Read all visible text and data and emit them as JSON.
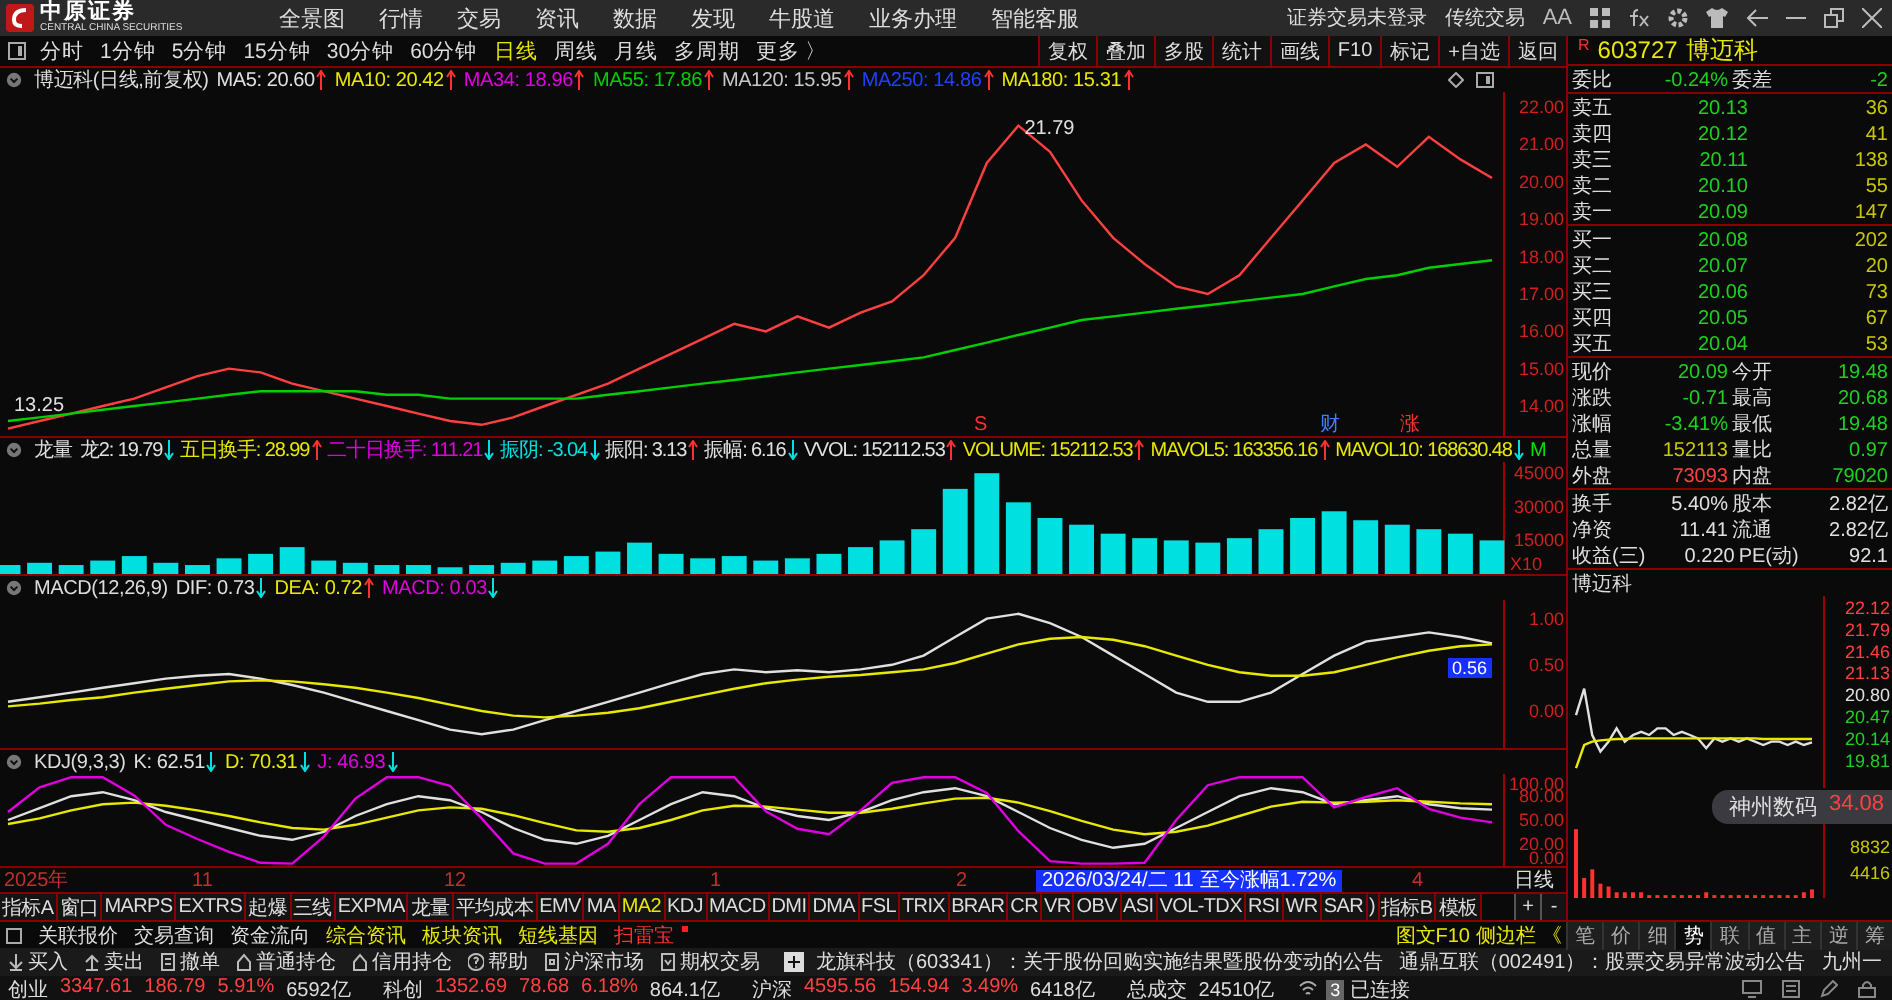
{
  "app_header": {
    "logo_text": "中原证券",
    "logo_subtitle": "CENTRAL CHINA SECURITIES",
    "nav": [
      "全景图",
      "行情",
      "交易",
      "资讯",
      "数据",
      "发现",
      "牛股道",
      "业务办理",
      "智能客服"
    ],
    "status": [
      "证券交易未登录",
      "传统交易"
    ],
    "font_icon": "AA"
  },
  "periods": [
    {
      "label": "分时",
      "selected": false
    },
    {
      "label": "1分钟",
      "selected": false
    },
    {
      "label": "5分钟",
      "selected": false
    },
    {
      "label": "15分钟",
      "selected": false
    },
    {
      "label": "30分钟",
      "selected": false
    },
    {
      "label": "60分钟",
      "selected": false
    },
    {
      "label": "日线",
      "selected": true
    },
    {
      "label": "周线",
      "selected": false
    },
    {
      "label": "月线",
      "selected": false
    },
    {
      "label": "多周期",
      "selected": false
    },
    {
      "label": "更多 〉",
      "selected": false
    }
  ],
  "chart_tools": [
    "复权",
    "叠加",
    "多股",
    "统计",
    "画线",
    "F10",
    "标记",
    "+自选",
    "返回"
  ],
  "main_panel": {
    "title": "博迈科(日线,前复权)",
    "indicators": [
      {
        "text": "MA5: 20.60",
        "rising": true,
        "color": "#e0e0e0"
      },
      {
        "text": "MA10: 20.42",
        "rising": true,
        "color": "#e8e800"
      },
      {
        "text": "MA34: 18.96",
        "rising": true,
        "color": "#e000e0"
      },
      {
        "text": "MA55: 17.86",
        "rising": true,
        "color": "#00d000"
      },
      {
        "text": "MA120: 15.95",
        "rising": true,
        "color": "#c8c8c8"
      },
      {
        "text": "MA250: 14.86",
        "rising": true,
        "color": "#2040ff"
      },
      {
        "text": "MA180: 15.31",
        "rising": true,
        "color": "#e8e800"
      }
    ],
    "high_label": "21.79",
    "low_label": "13.25",
    "markers": [
      {
        "label": "S",
        "kind": "sell"
      },
      {
        "label": "财",
        "kind": "report"
      },
      {
        "label": "涨",
        "kind": "rise"
      }
    ],
    "chart_data": {
      "type": "line",
      "ylim": [
        13.2,
        22.4
      ],
      "yticks": [
        {
          "value": 14,
          "label": "14.00"
        },
        {
          "value": 15,
          "label": "15.00"
        },
        {
          "value": 16,
          "label": "16.00"
        },
        {
          "value": 17,
          "label": "17.00"
        },
        {
          "value": 18,
          "label": "18.00"
        },
        {
          "value": 19,
          "label": "19.00"
        },
        {
          "value": 20,
          "label": "20.00"
        },
        {
          "value": 21,
          "label": "21.00"
        },
        {
          "value": 22,
          "label": "22.00"
        }
      ],
      "series": [
        {
          "color": "#ff4040",
          "values": [
            13.4,
            13.6,
            13.8,
            14.0,
            14.2,
            14.5,
            14.8,
            15.0,
            14.9,
            14.6,
            14.4,
            14.2,
            14.0,
            13.8,
            13.6,
            13.5,
            13.7,
            14.0,
            14.3,
            14.6,
            15.0,
            15.4,
            15.8,
            16.2,
            16.0,
            16.4,
            16.1,
            16.5,
            16.8,
            17.5,
            18.5,
            20.5,
            21.5,
            20.8,
            19.5,
            18.5,
            17.8,
            17.2,
            17.0,
            17.5,
            18.5,
            19.5,
            20.5,
            21.0,
            20.4,
            21.2,
            20.6,
            20.1
          ]
        },
        {
          "color": "#00d000",
          "values": [
            13.6,
            13.7,
            13.8,
            13.9,
            14.0,
            14.1,
            14.2,
            14.3,
            14.4,
            14.4,
            14.4,
            14.4,
            14.3,
            14.3,
            14.2,
            14.2,
            14.2,
            14.2,
            14.2,
            14.3,
            14.4,
            14.5,
            14.6,
            14.7,
            14.8,
            14.9,
            15.0,
            15.1,
            15.2,
            15.3,
            15.5,
            15.7,
            15.9,
            16.1,
            16.3,
            16.4,
            16.5,
            16.6,
            16.7,
            16.8,
            16.9,
            17.0,
            17.2,
            17.4,
            17.5,
            17.7,
            17.8,
            17.9
          ]
        }
      ]
    }
  },
  "volume_panel": {
    "title": "龙量",
    "indicators": [
      {
        "text": "龙2: 19.79",
        "rising": false,
        "color": "#e0e0e0"
      },
      {
        "text": "五日换手: 28.99",
        "rising": true,
        "color": "#e8e800"
      },
      {
        "text": "二十日换手: 111.21",
        "rising": false,
        "color": "#e000e0"
      },
      {
        "text": "振阴: -3.04",
        "rising": false,
        "color": "#00e0e0"
      },
      {
        "text": "振阳: 3.13",
        "rising": true,
        "color": "#e0e0e0"
      },
      {
        "text": "振幅: 6.16",
        "rising": false,
        "color": "#e0e0e0"
      },
      {
        "text": "VVOL: 152112.53",
        "rising": true,
        "color": "#e0e0e0"
      },
      {
        "text": "VOLUME: 152112.53",
        "rising": true,
        "color": "#e8e800"
      },
      {
        "text": "MAVOL5: 163356.16",
        "rising": true,
        "color": "#e8e800"
      },
      {
        "text": "MAVOL10: 168630.48",
        "rising": false,
        "color": "#e8e800"
      },
      {
        "text": "M",
        "color": "#00e000"
      }
    ],
    "unit": "X10",
    "chart_data": {
      "type": "bar",
      "ylim": [
        0,
        50000
      ],
      "yticks": [
        {
          "value": 15000,
          "label": "15000"
        },
        {
          "value": 30000,
          "label": "30000"
        },
        {
          "value": 45000,
          "label": "45000"
        }
      ],
      "series": [
        {
          "color": "#00e0e0",
          "values": [
            4000,
            5000,
            4000,
            6000,
            8000,
            5000,
            4000,
            7000,
            9000,
            12000,
            6000,
            5000,
            4000,
            4000,
            3000,
            4000,
            5000,
            6000,
            8000,
            10000,
            14000,
            9000,
            7000,
            8000,
            6000,
            7000,
            9000,
            12000,
            15000,
            20000,
            38000,
            45000,
            32000,
            25000,
            22000,
            18000,
            16000,
            15000,
            14000,
            16000,
            20000,
            25000,
            28000,
            24000,
            22000,
            20000,
            18000,
            15000
          ]
        }
      ]
    }
  },
  "macd_panel": {
    "title": "MACD(12,26,9)",
    "indicators": [
      {
        "text": "DIF: 0.73",
        "rising": false,
        "color": "#e0e0e0"
      },
      {
        "text": "DEA: 0.72",
        "rising": true,
        "color": "#e8e800"
      },
      {
        "text": "MACD: 0.03",
        "rising": false,
        "color": "#e000e0"
      }
    ],
    "cursor_value": "0.56",
    "chart_data": {
      "type": "line",
      "ylim": [
        -0.4,
        1.2
      ],
      "yticks": [
        {
          "value": 0,
          "label": "0.00"
        },
        {
          "value": 0.5,
          "label": "0.50"
        },
        {
          "value": 1,
          "label": "1.00"
        }
      ],
      "series": [
        {
          "color": "#e0e0e0",
          "values": [
            0.1,
            0.15,
            0.2,
            0.25,
            0.3,
            0.35,
            0.38,
            0.4,
            0.35,
            0.28,
            0.2,
            0.1,
            0.0,
            -0.1,
            -0.2,
            -0.25,
            -0.2,
            -0.1,
            0.0,
            0.1,
            0.2,
            0.3,
            0.4,
            0.45,
            0.42,
            0.44,
            0.42,
            0.45,
            0.5,
            0.6,
            0.8,
            1.0,
            1.05,
            0.95,
            0.8,
            0.6,
            0.4,
            0.2,
            0.1,
            0.1,
            0.2,
            0.4,
            0.6,
            0.75,
            0.8,
            0.85,
            0.8,
            0.73
          ]
        },
        {
          "color": "#e8e800",
          "values": [
            0.05,
            0.08,
            0.12,
            0.15,
            0.2,
            0.24,
            0.28,
            0.32,
            0.33,
            0.32,
            0.29,
            0.25,
            0.2,
            0.14,
            0.07,
            0.0,
            -0.05,
            -0.07,
            -0.05,
            -0.02,
            0.03,
            0.1,
            0.17,
            0.24,
            0.3,
            0.34,
            0.37,
            0.39,
            0.42,
            0.45,
            0.52,
            0.62,
            0.72,
            0.78,
            0.8,
            0.77,
            0.7,
            0.6,
            0.5,
            0.42,
            0.38,
            0.38,
            0.42,
            0.5,
            0.58,
            0.65,
            0.7,
            0.72
          ]
        }
      ]
    }
  },
  "kdj_panel": {
    "title": "KDJ(9,3,3)",
    "indicators": [
      {
        "text": "K: 62.51",
        "rising": false,
        "color": "#e0e0e0"
      },
      {
        "text": "D: 70.31",
        "rising": false,
        "color": "#e8e800"
      },
      {
        "text": "J: 46.93",
        "rising": false,
        "color": "#e000e0"
      }
    ],
    "chart_data": {
      "type": "line",
      "ylim": [
        -8,
        108
      ],
      "yticks": [
        {
          "value": 0,
          "label": "0.00"
        },
        {
          "value": 20,
          "label": "20.00"
        },
        {
          "value": 50,
          "label": "50.00"
        },
        {
          "value": 80,
          "label": "80.00"
        },
        {
          "value": 100,
          "label": "100.00"
        }
      ],
      "series": [
        {
          "color": "#e0e0e0",
          "values": [
            50,
            65,
            80,
            85,
            75,
            60,
            50,
            40,
            30,
            25,
            35,
            55,
            70,
            80,
            75,
            60,
            40,
            25,
            20,
            30,
            50,
            70,
            85,
            80,
            65,
            55,
            50,
            60,
            75,
            85,
            90,
            80,
            60,
            40,
            25,
            15,
            20,
            40,
            60,
            80,
            90,
            85,
            70,
            75,
            80,
            70,
            65,
            63
          ]
        },
        {
          "color": "#e8e800",
          "values": [
            45,
            52,
            62,
            70,
            72,
            68,
            62,
            55,
            47,
            40,
            38,
            44,
            53,
            62,
            66,
            64,
            56,
            46,
            37,
            35,
            40,
            50,
            62,
            68,
            67,
            63,
            59,
            59,
            64,
            71,
            77,
            78,
            72,
            61,
            49,
            38,
            32,
            35,
            43,
            55,
            67,
            73,
            72,
            73,
            75,
            73,
            71,
            70
          ]
        },
        {
          "color": "#e000e0",
          "values": [
            60,
            91,
            104,
            104,
            81,
            44,
            26,
            10,
            -4,
            -5,
            29,
            77,
            104,
            104,
            93,
            52,
            8,
            -5,
            -5,
            20,
            70,
            104,
            104,
            104,
            61,
            39,
            32,
            62,
            97,
            104,
            104,
            84,
            36,
            -2,
            -5,
            -5,
            -4,
            50,
            94,
            104,
            104,
            104,
            66,
            79,
            90,
            64,
            53,
            47
          ]
        }
      ]
    }
  },
  "date_axis": {
    "labels": [
      "2025年",
      "11",
      "12",
      "1",
      "2",
      "4"
    ],
    "cursor_label": "2026/03/24/二 11 至今涨幅1.72%",
    "period_label": "日线"
  },
  "indicator_tabs": [
    {
      "label": "指标A",
      "selected": false
    },
    {
      "label": "窗口",
      "selected": false
    },
    {
      "label": "MARPS",
      "selected": false
    },
    {
      "label": "EXTRS",
      "selected": false
    },
    {
      "label": "起爆",
      "selected": false
    },
    {
      "label": "三线",
      "selected": false
    },
    {
      "label": "EXPMA",
      "selected": false
    },
    {
      "label": "龙量",
      "selected": false
    },
    {
      "label": "平均成本",
      "selected": false
    },
    {
      "label": "EMV",
      "selected": false
    },
    {
      "label": "MA",
      "selected": false
    },
    {
      "label": "MA2",
      "selected": true
    },
    {
      "label": "KDJ",
      "selected": false
    },
    {
      "label": "MACD",
      "selected": false
    },
    {
      "label": "DMI",
      "selected": false
    },
    {
      "label": "DMA",
      "selected": false
    },
    {
      "label": "FSL",
      "selected": false
    },
    {
      "label": "TRIX",
      "selected": false
    },
    {
      "label": "BRAR",
      "selected": false
    },
    {
      "label": "CR",
      "selected": false
    },
    {
      "label": "VR",
      "selected": false
    },
    {
      "label": "OBV",
      "selected": false
    },
    {
      "label": "ASI",
      "selected": false
    },
    {
      "label": "VOL-TDX",
      "selected": false
    },
    {
      "label": "RSI",
      "selected": false
    },
    {
      "label": "WR",
      "selected": false
    },
    {
      "label": "SAR",
      "selected": false
    },
    {
      "label": ")",
      "selected": false
    },
    {
      "label": "指标B",
      "selected": false
    },
    {
      "label": "模板",
      "selected": false
    }
  ],
  "zoom_buttons": [
    "+",
    "-"
  ],
  "quote": {
    "flag": "R",
    "code": "603727",
    "name": "博迈科",
    "ratio": [
      {
        "label": "委比",
        "value": "-0.24%",
        "color": "#20d020"
      },
      {
        "label": "委差",
        "value": "-2",
        "color": "#20d020"
      }
    ],
    "asks": [
      {
        "label": "卖五",
        "price": "20.13",
        "volume": "36"
      },
      {
        "label": "卖四",
        "price": "20.12",
        "volume": "41"
      },
      {
        "label": "卖三",
        "price": "20.11",
        "volume": "138"
      },
      {
        "label": "卖二",
        "price": "20.10",
        "volume": "55"
      },
      {
        "label": "卖一",
        "price": "20.09",
        "volume": "147"
      }
    ],
    "bids": [
      {
        "label": "买一",
        "price": "20.08",
        "volume": "202"
      },
      {
        "label": "买二",
        "price": "20.07",
        "volume": "20"
      },
      {
        "label": "买三",
        "price": "20.06",
        "volume": "73"
      },
      {
        "label": "买四",
        "price": "20.05",
        "volume": "67"
      },
      {
        "label": "买五",
        "price": "20.04",
        "volume": "53"
      }
    ],
    "stats": [
      [
        {
          "label": "现价",
          "value": "20.09",
          "color": "#20d020"
        },
        {
          "label": "今开",
          "value": "19.48",
          "color": "#20d020"
        }
      ],
      [
        {
          "label": "涨跌",
          "value": "-0.71",
          "color": "#20d020"
        },
        {
          "label": "最高",
          "value": "20.68",
          "color": "#20d020"
        }
      ],
      [
        {
          "label": "涨幅",
          "value": "-3.41%",
          "color": "#20d020"
        },
        {
          "label": "最低",
          "value": "19.48",
          "color": "#20d020"
        }
      ],
      [
        {
          "label": "总量",
          "value": "152113",
          "color": "#c8c800"
        },
        {
          "label": "量比",
          "value": "0.97",
          "color": "#20d020"
        }
      ],
      [
        {
          "label": "外盘",
          "value": "73093",
          "color": "#ff4040"
        },
        {
          "label": "内盘",
          "value": "79020",
          "color": "#20d020"
        }
      ]
    ],
    "info": [
      [
        {
          "label": "换手",
          "value": "5.40%",
          "color": "#e0e0e0"
        },
        {
          "label": "股本",
          "value": "2.82亿",
          "color": "#e0e0e0"
        }
      ],
      [
        {
          "label": "净资",
          "value": "11.41",
          "color": "#e0e0e0"
        },
        {
          "label": "流通",
          "value": "2.82亿",
          "color": "#e0e0e0"
        }
      ],
      [
        {
          "label": "收益(三)",
          "value": "0.220",
          "color": "#e0e0e0"
        },
        {
          "label": "PE(动)",
          "value": "92.1",
          "color": "#e0e0e0"
        }
      ]
    ]
  },
  "intraday": {
    "title": "博迈科",
    "chart_data": {
      "type": "line",
      "ylim": [
        19.4,
        22.3
      ],
      "yticks": [
        {
          "value": 22.12,
          "label": "22.12"
        },
        {
          "value": 21.79,
          "label": "21.79"
        },
        {
          "value": 21.46,
          "label": "21.46"
        },
        {
          "value": 21.13,
          "label": "21.13"
        },
        {
          "value": 20.8,
          "label": "20.80"
        },
        {
          "value": 20.47,
          "label": "20.47"
        },
        {
          "value": 20.14,
          "label": "20.14"
        },
        {
          "value": 19.81,
          "label": "19.81"
        }
      ],
      "series": [
        {
          "color": "#e0e0e0",
          "values": [
            20.5,
            20.9,
            20.2,
            19.95,
            20.1,
            20.3,
            20.1,
            20.2,
            20.25,
            20.2,
            20.3,
            20.3,
            20.2,
            20.25,
            20.2,
            20.15,
            20.0,
            20.15,
            20.1,
            20.15,
            20.1,
            20.15,
            20.1,
            20.05,
            20.1,
            20.1,
            20.05,
            20.1,
            20.05,
            20.09
          ]
        },
        {
          "color": "#e8e800",
          "values": [
            19.7,
            20.05,
            20.1,
            20.12,
            20.13,
            20.14,
            20.14,
            20.15,
            20.15,
            20.15,
            20.15,
            20.15,
            20.15,
            20.15,
            20.15,
            20.15,
            20.15,
            20.15,
            20.15,
            20.15,
            20.15,
            20.15,
            20.15,
            20.14,
            20.14,
            20.14,
            20.14,
            20.14,
            20.14,
            20.14
          ]
        }
      ]
    }
  },
  "intraday_volume": {
    "chart_data": {
      "type": "bar",
      "ylim": [
        0,
        13248
      ],
      "yticks": [
        {
          "value": 4416,
          "label": "4416"
        },
        {
          "value": 8832,
          "label": "8832"
        }
      ],
      "series": [
        {
          "color": "#ff3030",
          "values": [
            12000,
            3500,
            5000,
            2500,
            2000,
            1000,
            1000,
            1000,
            1000,
            500,
            500,
            500,
            500,
            500,
            500,
            500,
            1000,
            500,
            500,
            500,
            500,
            500,
            500,
            500,
            500,
            500,
            500,
            500,
            1000,
            1500
          ]
        }
      ]
    }
  },
  "popup": {
    "name": "神州数码",
    "price": "34.08"
  },
  "side_links": [
    "图文F10",
    "侧边栏",
    "《"
  ],
  "quote_tabs": [
    {
      "label": "笔",
      "selected": false
    },
    {
      "label": "价",
      "selected": false
    },
    {
      "label": "细",
      "selected": false
    },
    {
      "label": "势",
      "selected": true
    },
    {
      "label": "联",
      "selected": false
    },
    {
      "label": "值",
      "selected": false
    },
    {
      "label": "主",
      "selected": false
    },
    {
      "label": "逆",
      "selected": false
    },
    {
      "label": "筹",
      "selected": false
    }
  ],
  "function_tabs": [
    {
      "label": "关联报价",
      "kind": "plain"
    },
    {
      "label": "交易查询",
      "kind": "plain"
    },
    {
      "label": "资金流向",
      "kind": "plain"
    },
    {
      "label": "综合资讯",
      "kind": "highlight"
    },
    {
      "label": "板块资讯",
      "kind": "highlight"
    },
    {
      "label": "短线基因",
      "kind": "highlight"
    },
    {
      "label": "扫雷宝",
      "kind": "alert"
    }
  ],
  "trade_toolbar": [
    {
      "label": "买入",
      "kind": "buy"
    },
    {
      "label": "卖出",
      "kind": "sell"
    },
    {
      "label": "撤单",
      "kind": "cancel"
    },
    {
      "label": "普通持仓",
      "kind": "home"
    },
    {
      "label": "信用持仓",
      "kind": "home"
    },
    {
      "label": "帮助",
      "kind": "help"
    },
    {
      "label": "沪深市场",
      "kind": "market"
    },
    {
      "label": "期权交易",
      "kind": "option"
    }
  ],
  "news": [
    "龙旗科技（603341）：关于股份回购实施结果暨股份变动的公告",
    "通鼎互联（002491）：股票交易异常波动公告",
    "九州一"
  ],
  "index_bar": {
    "items": [
      {
        "name": "创业",
        "value": "3347.61",
        "change": "186.79",
        "pct": "5.91%",
        "amount": "6592亿",
        "color": "#ff4040"
      },
      {
        "name": "科创",
        "value": "1352.69",
        "change": "78.68",
        "pct": "6.18%",
        "amount": "864.1亿",
        "color": "#ff4040"
      },
      {
        "name": "沪深",
        "value": "4595.56",
        "change": "154.94",
        "pct": "3.49%",
        "amount": "6418亿",
        "color": "#ff4040"
      }
    ],
    "total_label": "总成交",
    "total": "24510亿",
    "connections": "3",
    "connection_status": "已连接"
  }
}
